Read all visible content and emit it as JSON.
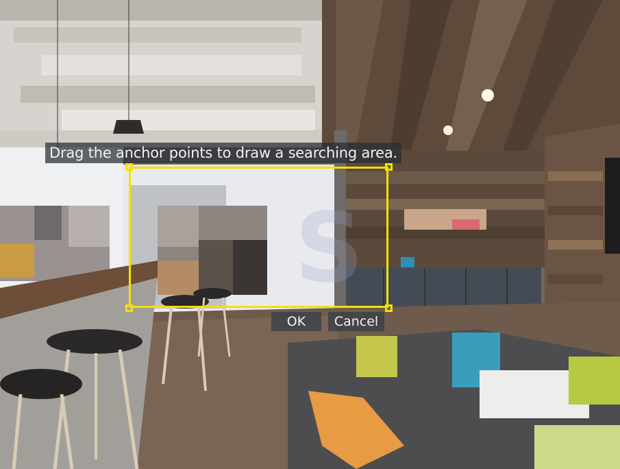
{
  "overlay": {
    "hint_text": "Drag the anchor points to draw a searching area.",
    "ok_label": "OK",
    "cancel_label": "Cancel",
    "area_color": "#f5e000"
  },
  "scene": {
    "description_colors": {
      "ceiling_left": "#d8d4cf",
      "ceiling_right": "#5a4a3c",
      "floor": "#6d5a4a",
      "wall_center": "#e9ebef",
      "counter": "#7c5c45",
      "sofa": "#4a4a4a"
    }
  }
}
